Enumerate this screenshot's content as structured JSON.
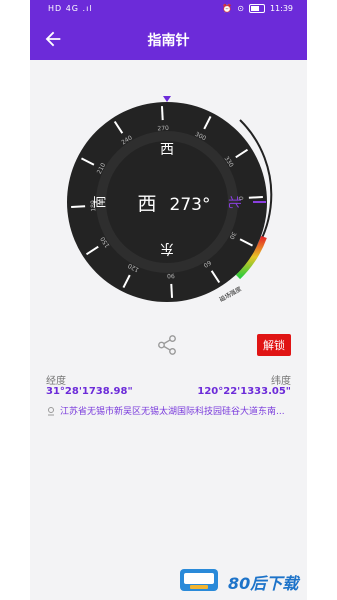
{
  "status": {
    "left": "HD 4G .ıl",
    "time": "11:39"
  },
  "appbar": {
    "title": "指南针"
  },
  "compass": {
    "heading_deg": 273,
    "direction_label": "西",
    "heading_text": "273°",
    "cardinals": {
      "west": "西",
      "north": "北",
      "east": "东",
      "south": "南"
    },
    "tick_labels": [
      "0",
      "30",
      "60",
      "90",
      "120",
      "150",
      "180",
      "210",
      "240",
      "270",
      "300",
      "330"
    ],
    "gauge_label": "磁场强度"
  },
  "actions": {
    "unlock": "解锁"
  },
  "location": {
    "longitude_label": "经度",
    "longitude_value": "31°28'1738.98\"",
    "latitude_label": "纬度",
    "latitude_value": "120°22'1333.05\"",
    "address": "江苏省无锡市新吴区无锡太湖国际科技园硅谷大道东南..."
  },
  "watermark": {
    "text": "80后下载"
  },
  "colors": {
    "primary": "#6c2bd9",
    "dial": "#232323",
    "unlock_red": "#e01414"
  }
}
